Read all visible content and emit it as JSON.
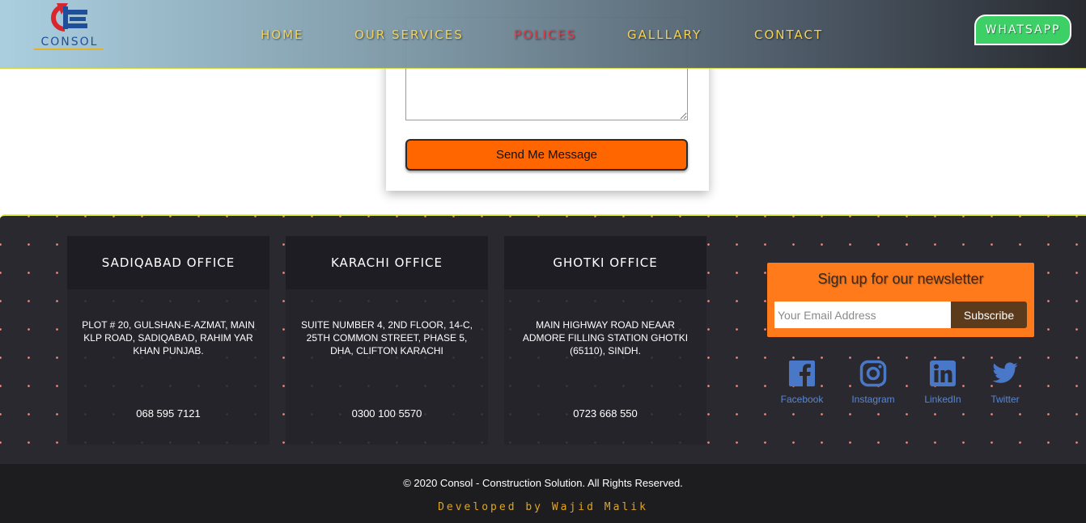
{
  "header": {
    "logo_text": "CONSOL",
    "nav": [
      {
        "label": "HOME",
        "active": false
      },
      {
        "label": "OUR SERVICES",
        "active": false
      },
      {
        "label": "POLICES",
        "active": true
      },
      {
        "label": "GALLLARY",
        "active": false
      },
      {
        "label": "CONTACT",
        "active": false
      }
    ],
    "whatsapp_label": "WHATSAPP"
  },
  "form": {
    "message_value": "",
    "submit_label": "Send Me Message"
  },
  "offices": [
    {
      "name": "SADIQABAD OFFICE",
      "address": "PLOT # 20, GULSHAN-E-AZMAT, MAIN KLP ROAD, SADIQABAD, RAHIM YAR KHAN PUNJAB.",
      "phone": "068 595 7121"
    },
    {
      "name": "KARACHI OFFICE",
      "address": "SUITE NUMBER 4, 2ND FLOOR, 14-C, 25TH COMMON STREET, PHASE 5, DHA, CLIFTON KARACHI",
      "phone": "0300 100 5570"
    },
    {
      "name": "GHOTKI OFFICE",
      "address": "MAIN HIGHWAY ROAD NEAAR ADMORE FILLING STATION GHOTKI (65110), SINDH.",
      "phone": "0723 668 550"
    }
  ],
  "newsletter": {
    "title": "Sign up for our newsletter",
    "email_placeholder": "Your Email Address",
    "subscribe_label": "Subscribe"
  },
  "social": [
    {
      "label": "Facebook",
      "icon": "facebook-icon"
    },
    {
      "label": "Instagram",
      "icon": "instagram-icon"
    },
    {
      "label": "LinkedIn",
      "icon": "linkedin-icon"
    },
    {
      "label": "Twitter",
      "icon": "twitter-icon"
    }
  ],
  "footer": {
    "copyright": "© 2020 Consol - Construction Solution. All Rights Reserved.",
    "developer": "Developed by Wajid Malik"
  },
  "colors": {
    "accent_orange": "#ff6600",
    "footer_bg": "#2a2930",
    "nav_text": "#f0d25a",
    "nav_active": "#e23b4a",
    "whatsapp_green": "#3dd067",
    "social_blue": "#4a78c8"
  }
}
